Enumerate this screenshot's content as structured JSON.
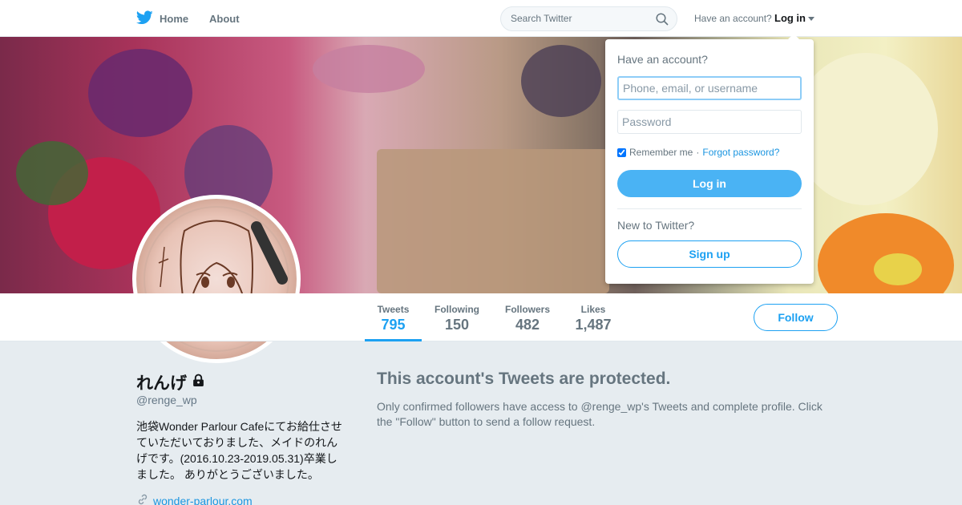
{
  "nav": {
    "home_label": "Home",
    "about_label": "About",
    "search_placeholder": "Search Twitter",
    "account_prompt": "Have an account?",
    "login_label": "Log in"
  },
  "stats": [
    {
      "label": "Tweets",
      "value": "795"
    },
    {
      "label": "Following",
      "value": "150"
    },
    {
      "label": "Followers",
      "value": "482"
    },
    {
      "label": "Likes",
      "value": "1,487"
    }
  ],
  "follow_label": "Follow",
  "profile": {
    "name": "れんげ",
    "handle": "@renge_wp",
    "bio": "池袋Wonder Parlour Cafeにてお給仕させていただいておりました、メイドのれんげです。(2016.10.23-2019.05.31)卒業しました。 ありがとうございました。",
    "url": "wonder-parlour.com"
  },
  "protected": {
    "title": "This account's Tweets are protected.",
    "text": "Only confirmed followers have access to @renge_wp's Tweets and complete profile. Click the \"Follow\" button to send a follow request."
  },
  "login_dropdown": {
    "heading": "Have an account?",
    "username_placeholder": "Phone, email, or username",
    "password_placeholder": "Password",
    "remember_label": "Remember me",
    "separator": "·",
    "forgot_label": "Forgot password?",
    "login_button": "Log in",
    "new_prompt": "New to Twitter?",
    "signup_button": "Sign up"
  },
  "colors": {
    "accent": "#1da1f2",
    "login_button_bg": "#4ab3f4",
    "link": "#1b95e0",
    "page_bg": "#e6ecf0"
  },
  "icons": [
    "twitter-bird-icon",
    "search-icon",
    "caret-down-icon",
    "lock-icon",
    "link-icon"
  ]
}
